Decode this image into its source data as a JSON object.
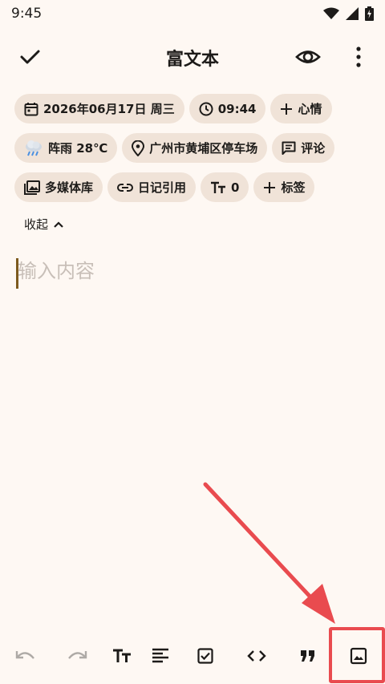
{
  "status_bar": {
    "time": "9:45",
    "icons": [
      "wifi-icon",
      "cell-signal-icon",
      "battery-charging-icon"
    ]
  },
  "app_bar": {
    "title": "富文本",
    "confirm_icon": "check-icon",
    "preview_icon": "eye-icon",
    "menu_icon": "more-vert-icon"
  },
  "chips": {
    "date": "2026年06月17日 周三",
    "time": "09:44",
    "mood": "心情",
    "weather": "阵雨 28℃",
    "location": "广州市黄埔区停车场",
    "comment": "评论",
    "media": "多媒体库",
    "diary_ref": "日记引用",
    "word_count": "0",
    "tags": "标签"
  },
  "collapse": {
    "label": "收起"
  },
  "editor": {
    "placeholder": "输入内容",
    "value": ""
  },
  "toolbar": {
    "items": [
      "undo-icon",
      "redo-icon",
      "text-size-icon",
      "align-icon",
      "checkbox-icon",
      "code-icon",
      "quote-icon",
      "image-icon"
    ]
  },
  "annotation": {
    "color": "#e94b4f"
  }
}
